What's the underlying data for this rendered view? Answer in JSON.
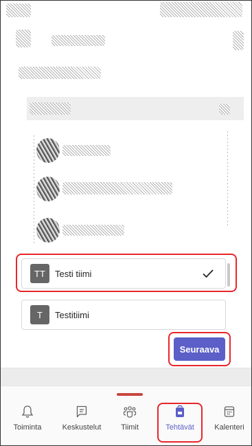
{
  "teams": [
    {
      "initials": "TT",
      "name": "Testi tiimi",
      "selected": true
    },
    {
      "initials": "T",
      "name": "Testitiimi",
      "selected": false
    }
  ],
  "next_button": {
    "label": "Seuraava"
  },
  "bottom_nav": [
    {
      "label": "Toiminta",
      "icon": "bell-icon"
    },
    {
      "label": "Keskustelut",
      "icon": "chat-icon"
    },
    {
      "label": "Tiimit",
      "icon": "teams-icon"
    },
    {
      "label": "Tehtävät",
      "icon": "assignments-icon",
      "active": true
    },
    {
      "label": "Kalenteri",
      "icon": "calendar-icon"
    }
  ],
  "colors": {
    "accent": "#5b5fc7",
    "highlight": "#e8262a",
    "avatar": "#666666"
  }
}
